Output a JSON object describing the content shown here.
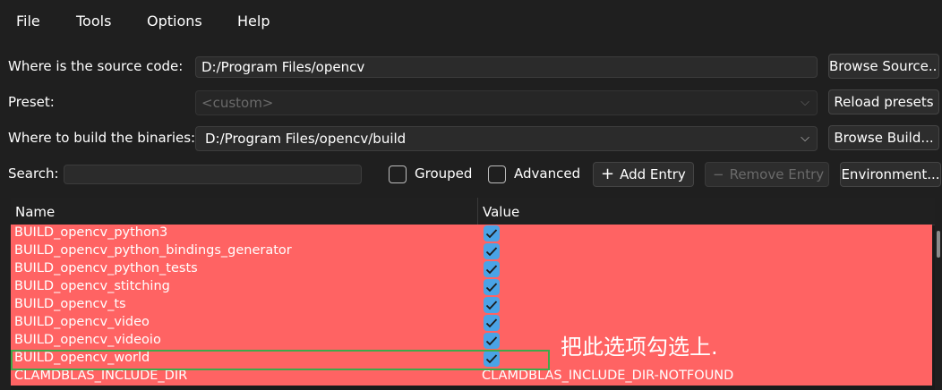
{
  "menu": {
    "file": "File",
    "tools": "Tools",
    "options": "Options",
    "help": "Help"
  },
  "source": {
    "label": "Where is the source code:",
    "value": "D:/Program Files/opencv",
    "browse_label": "Browse Source..."
  },
  "preset": {
    "label": "Preset:",
    "value": "<custom>",
    "reload_label": "Reload presets"
  },
  "build": {
    "label": "Where to build the binaries:",
    "value": "D:/Program Files/opencv/build",
    "browse_label": "Browse Build..."
  },
  "search": {
    "label": "Search:",
    "value": ""
  },
  "toolbar": {
    "grouped_label": "Grouped",
    "grouped_checked": false,
    "advanced_label": "Advanced",
    "advanced_checked": false,
    "add_entry_label": "Add Entry",
    "remove_entry_label": "Remove Entry",
    "environment_label": "Environment..."
  },
  "table": {
    "columns": [
      "Name",
      "Value"
    ],
    "rows": [
      {
        "name": "BUILD_opencv_python3",
        "checked": true
      },
      {
        "name": "BUILD_opencv_python_bindings_generator",
        "checked": true
      },
      {
        "name": "BUILD_opencv_python_tests",
        "checked": true
      },
      {
        "name": "BUILD_opencv_stitching",
        "checked": true
      },
      {
        "name": "BUILD_opencv_ts",
        "checked": true
      },
      {
        "name": "BUILD_opencv_video",
        "checked": true
      },
      {
        "name": "BUILD_opencv_videoio",
        "checked": true
      },
      {
        "name": "BUILD_opencv_world",
        "checked": true
      },
      {
        "name": "CLAMDBLAS_INCLUDE_DIR",
        "value": "CLAMDBLAS_INCLUDE_DIR-NOTFOUND"
      }
    ],
    "row_color": "#ff6363",
    "check_color": "#4aa3e6"
  },
  "annotation": {
    "text": "把此选项勾选上.",
    "box_color": "#3fa84a"
  }
}
